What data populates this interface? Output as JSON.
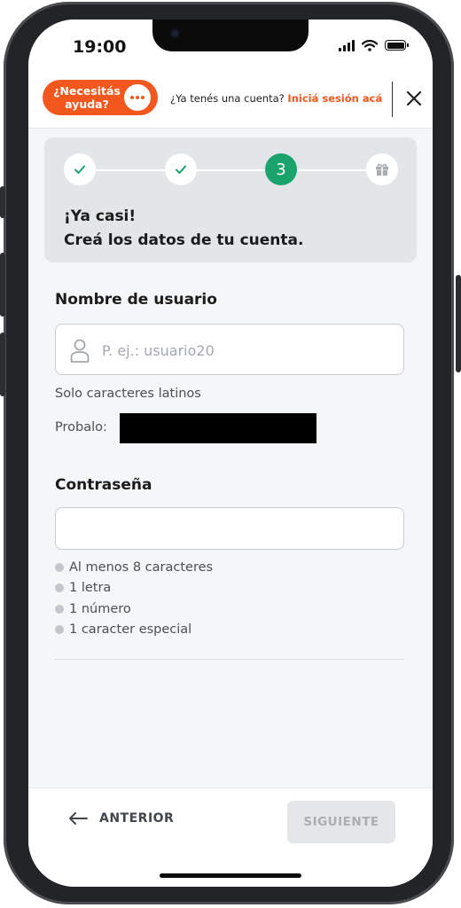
{
  "status_bar": {
    "time": "19:00"
  },
  "topbar": {
    "help_label": "¿Necesitás\nayuda?",
    "login_question": "¿Ya tenés una cuenta?",
    "login_link": "Iniciá sesión acá"
  },
  "steps": {
    "current_number": "3",
    "title_line1": "¡Ya casi!",
    "title_line2": "Creá los datos de tu cuenta."
  },
  "username": {
    "label": "Nombre de usuario",
    "placeholder": "P. ej.: usuario20",
    "value": "",
    "hint": "Solo caracteres latinos",
    "suggestion_label": "Probalo:"
  },
  "password": {
    "label": "Contraseña",
    "value": "",
    "rules": [
      "Al menos 8 caracteres",
      "1 letra",
      "1 número",
      "1 caracter especial"
    ]
  },
  "footer": {
    "back_label": "ANTERIOR",
    "next_label": "SIGUIENTE"
  },
  "colors": {
    "accent": "#f2581d",
    "success": "#1aa36a",
    "disabled": "#e4e6e8"
  }
}
